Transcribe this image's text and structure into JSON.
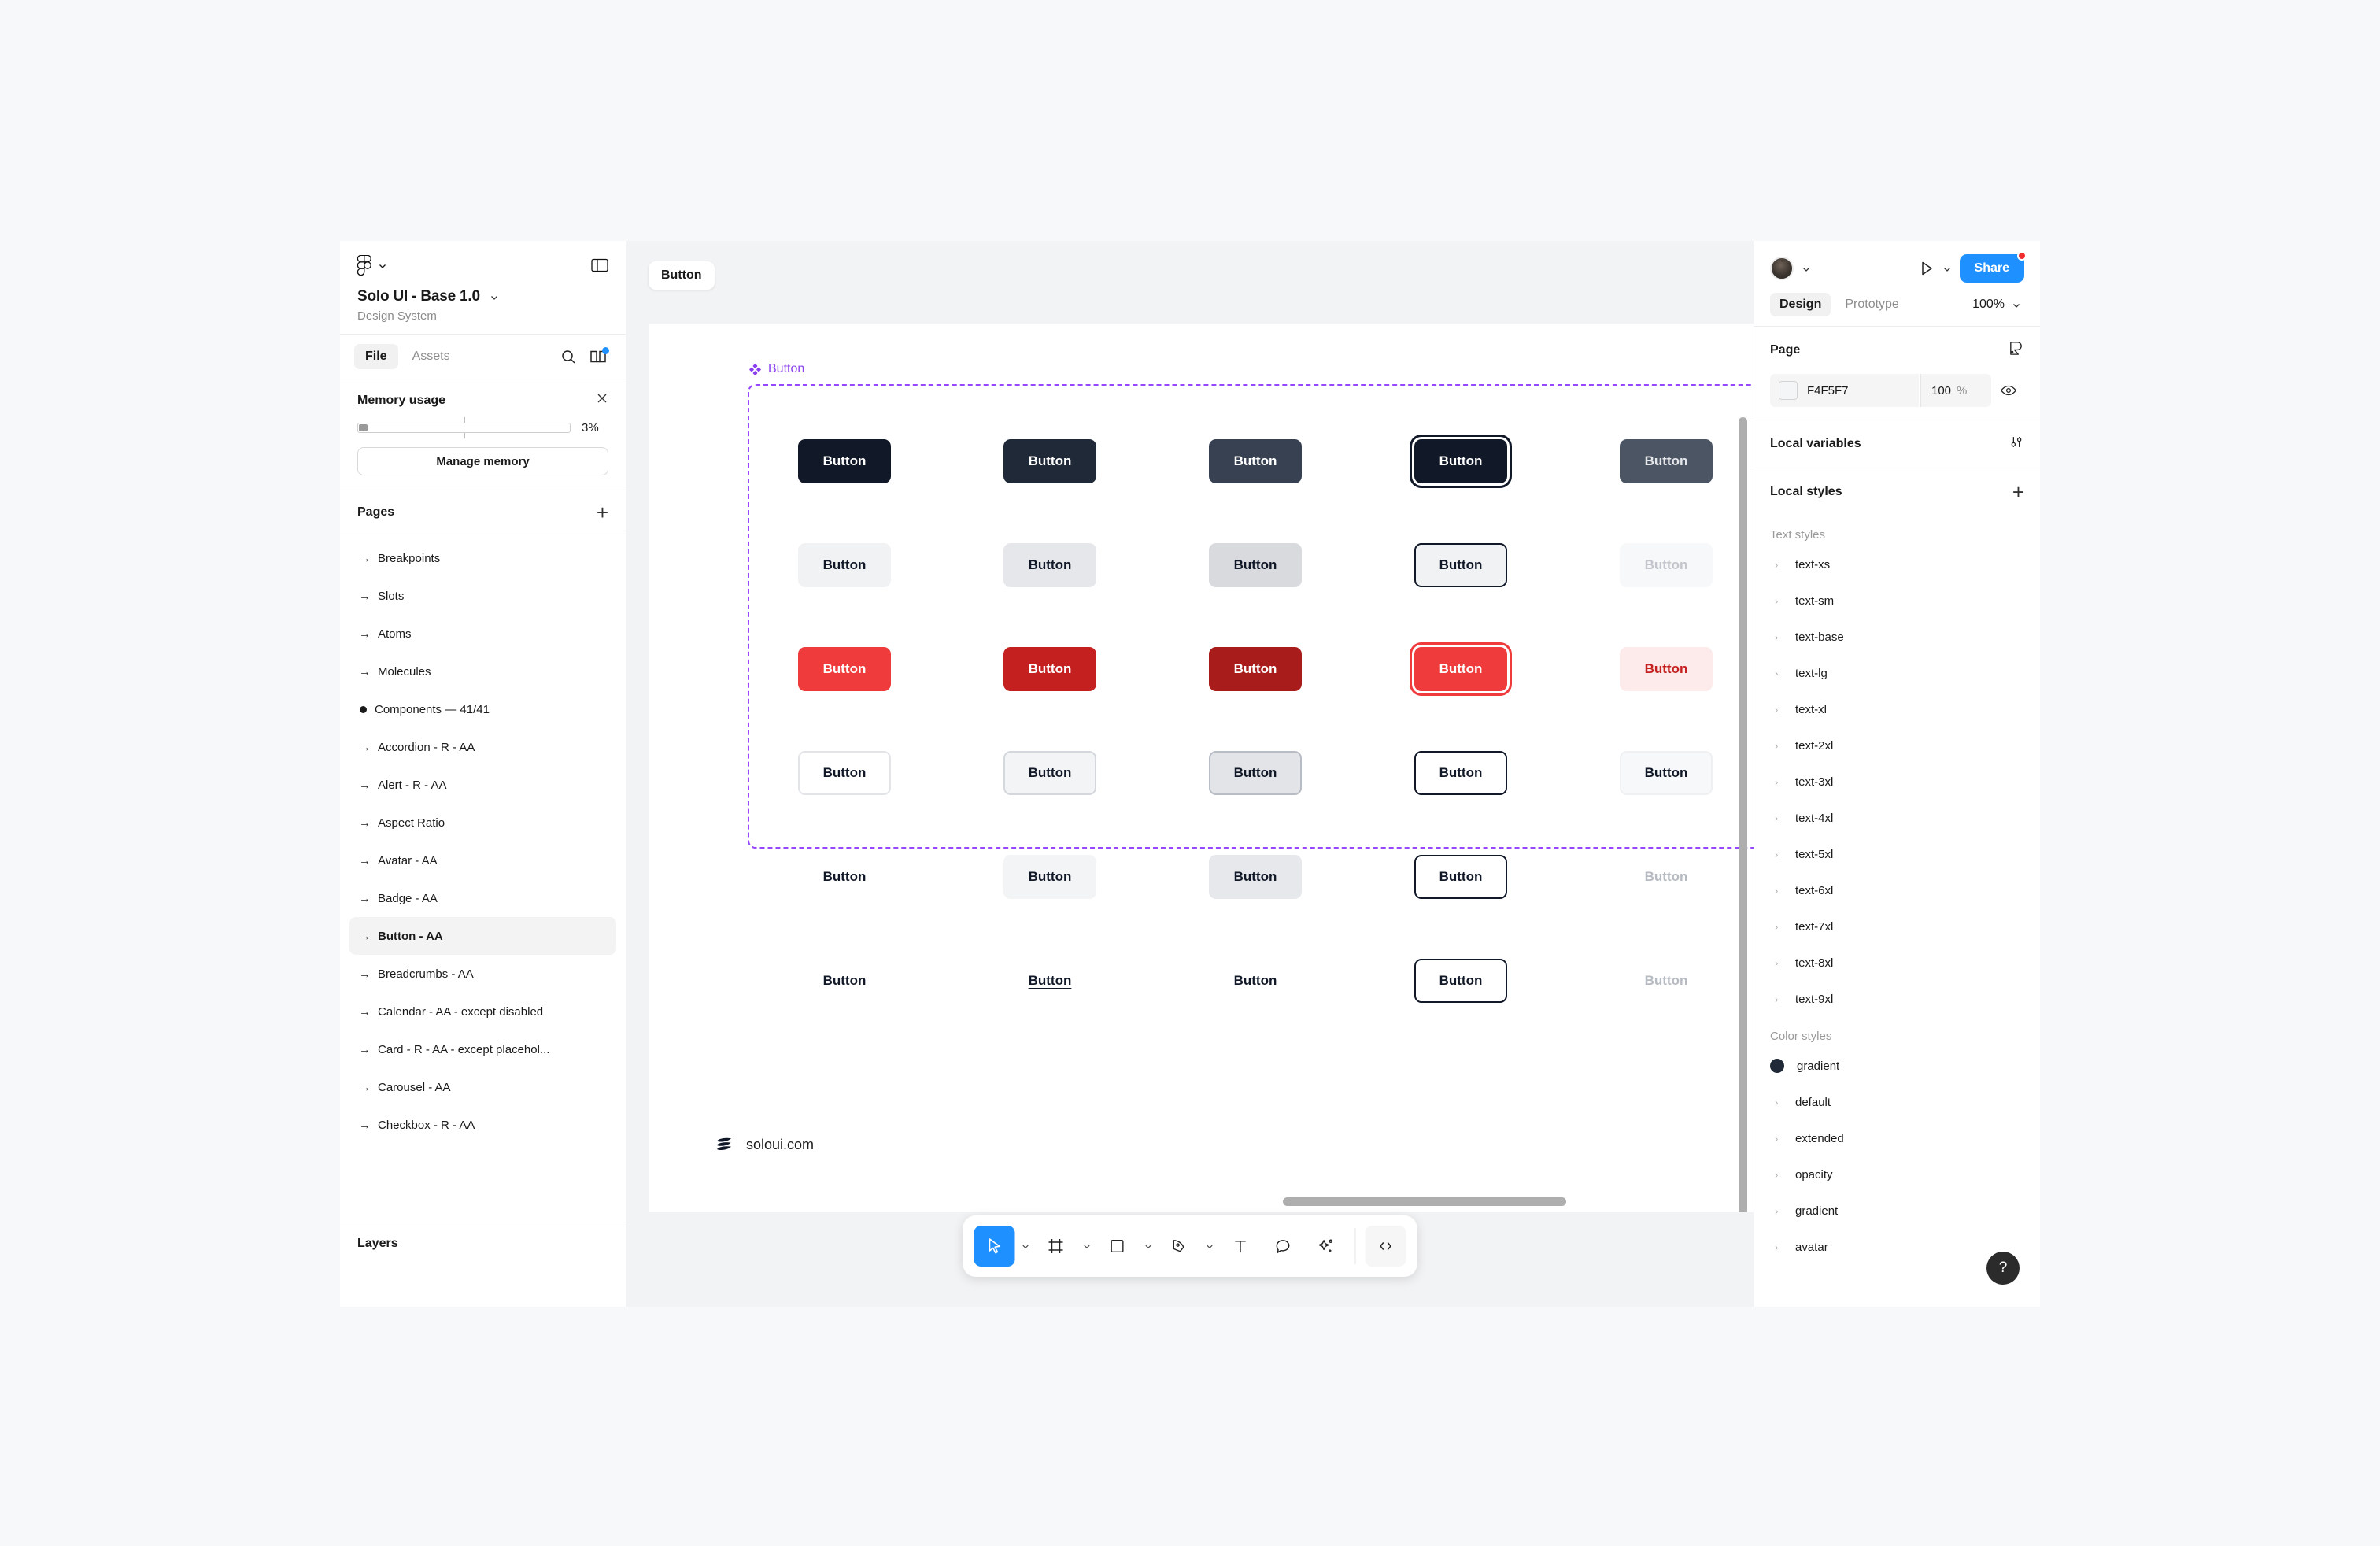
{
  "left_sidebar": {
    "logo_icon": "figma-logo-icon",
    "logo_chevron_icon": "chevron-down-icon",
    "panel_toggle_icon": "panel-toggle-icon",
    "file_title": "Solo UI - Base 1.0",
    "file_title_chevron_icon": "chevron-down-icon",
    "file_subtitle": "Design System",
    "tabs": [
      {
        "label": "File",
        "active": true
      },
      {
        "label": "Assets",
        "active": false
      }
    ],
    "search_icon": "search-icon",
    "library_icon": "book-library-icon",
    "memory": {
      "title": "Memory usage",
      "close_icon": "close-icon",
      "percent": "3%",
      "fill_percent": 3,
      "manage_label": "Manage memory"
    },
    "pages": {
      "title": "Pages",
      "add_icon": "plus-icon",
      "items": [
        {
          "label": "Breakpoints",
          "marker": "arrow",
          "selected": false
        },
        {
          "label": "Slots",
          "marker": "arrow",
          "selected": false
        },
        {
          "label": "Atoms",
          "marker": "arrow",
          "selected": false
        },
        {
          "label": "Molecules",
          "marker": "arrow",
          "selected": false
        },
        {
          "label": "Components — 41/41",
          "marker": "bullet",
          "selected": false
        },
        {
          "label": "Accordion - R - AA",
          "marker": "arrow",
          "selected": false
        },
        {
          "label": "Alert - R - AA",
          "marker": "arrow",
          "selected": false
        },
        {
          "label": "Aspect Ratio",
          "marker": "arrow",
          "selected": false
        },
        {
          "label": "Avatar - AA",
          "marker": "arrow",
          "selected": false
        },
        {
          "label": "Badge - AA",
          "marker": "arrow",
          "selected": false
        },
        {
          "label": "Button - AA",
          "marker": "arrow",
          "selected": true
        },
        {
          "label": "Breadcrumbs  - AA",
          "marker": "arrow",
          "selected": false
        },
        {
          "label": "Calendar - AA - except disabled",
          "marker": "arrow",
          "selected": false
        },
        {
          "label": "Card - R - AA - except placehol...",
          "marker": "arrow",
          "selected": false
        },
        {
          "label": "Carousel  - AA",
          "marker": "arrow",
          "selected": false
        },
        {
          "label": "Checkbox - R - AA",
          "marker": "arrow",
          "selected": false
        }
      ]
    },
    "layers_title": "Layers"
  },
  "canvas": {
    "frame_chip_label": "Button",
    "component_label": "Button",
    "component_icon": "component-diamond-icon",
    "brand_link": "soloui.com",
    "brand_logo_icon": "solo-logo-icon",
    "vertical_scrollbar": "canvas-vertical-scrollbar",
    "horizontal_scrollbar": "canvas-horizontal-scrollbar",
    "button_label": "Button",
    "grid": [
      [
        {
          "label": "Button",
          "style": "background:#111827;color:#ffffff;"
        },
        {
          "label": "Button",
          "style": "background:#1f2937;color:#ffffff;"
        },
        {
          "label": "Button",
          "style": "background:#374151;color:#ffffff;"
        },
        {
          "label": "Button",
          "style": "background:#111827;color:#ffffff;",
          "focus": "dark"
        },
        {
          "label": "Button",
          "style": "background:#4b5563;color:#e5e7eb;"
        }
      ],
      [
        {
          "label": "Button",
          "style": "background:#f1f2f4;color:#111827;"
        },
        {
          "label": "Button",
          "style": "background:#e5e7eb;color:#111827;"
        },
        {
          "label": "Button",
          "style": "background:#d8dade;color:#111827;"
        },
        {
          "label": "Button",
          "style": "background:#f1f2f4;color:#111827;border-color:#111827;"
        },
        {
          "label": "Button",
          "style": "background:#f7f8f9;color:#c2c6cc;"
        }
      ],
      [
        {
          "label": "Button",
          "style": "background:#ef3b3b;color:#ffffff;"
        },
        {
          "label": "Button",
          "style": "background:#c4201f;color:#ffffff;"
        },
        {
          "label": "Button",
          "style": "background:#a81c1b;color:#ffffff;"
        },
        {
          "label": "Button",
          "style": "background:#ef3b3b;color:#ffffff;",
          "focus": "red"
        },
        {
          "label": "Button",
          "style": "background:#fdeaea;color:#c4201f;"
        }
      ],
      [
        {
          "label": "Button",
          "style": "background:#ffffff;color:#111827;border-color:#e2e4e8;"
        },
        {
          "label": "Button",
          "style": "background:#f3f4f6;color:#111827;border-color:#d4d7dc;"
        },
        {
          "label": "Button",
          "style": "background:#e2e4e8;color:#111827;border-color:#b8bcc4;"
        },
        {
          "label": "Button",
          "style": "background:#ffffff;color:#111827;border-color:#111827;"
        },
        {
          "label": "Button",
          "style": "background:#f7f8f9;color:#111827;border-color:#eef0f2;"
        }
      ],
      [
        {
          "label": "Button",
          "style": "background:transparent;color:#111827;"
        },
        {
          "label": "Button",
          "style": "background:#f3f4f6;color:#111827;"
        },
        {
          "label": "Button",
          "style": "background:#e6e8ec;color:#111827;"
        },
        {
          "label": "Button",
          "style": "background:#ffffff;color:#111827;border-color:#111827;"
        },
        {
          "label": "Button",
          "style": "background:transparent;color:#b6bac1;"
        }
      ],
      [
        {
          "label": "Button",
          "style": "background:transparent;color:#111827;"
        },
        {
          "label": "Button",
          "style": "background:transparent;color:#111827;",
          "underline": true
        },
        {
          "label": "Button",
          "style": "background:transparent;color:#111827;"
        },
        {
          "label": "Button",
          "style": "background:#ffffff;color:#111827;border-color:#111827;"
        },
        {
          "label": "Button",
          "style": "background:transparent;color:#b6bac1;"
        }
      ]
    ]
  },
  "toolbar": {
    "tools": [
      {
        "name": "move-tool",
        "icon": "cursor-icon",
        "active": true,
        "chevron": true
      },
      {
        "name": "frame-tool",
        "icon": "frame-icon",
        "active": false,
        "chevron": true
      },
      {
        "name": "shape-tool",
        "icon": "square-icon",
        "active": false,
        "chevron": true
      },
      {
        "name": "pen-tool",
        "icon": "pen-icon",
        "active": false,
        "chevron": true
      },
      {
        "name": "text-tool",
        "icon": "text-icon",
        "active": false,
        "chevron": false
      },
      {
        "name": "comment-tool",
        "icon": "comment-icon",
        "active": false,
        "chevron": false
      },
      {
        "name": "actions-tool",
        "icon": "sparkle-icon",
        "active": false,
        "chevron": false
      }
    ],
    "dev_mode": {
      "name": "dev-mode-toggle",
      "icon": "code-icon"
    }
  },
  "right_panel": {
    "avatar_icon": "user-avatar",
    "avatar_chevron_icon": "chevron-down-icon",
    "present_icon": "play-icon",
    "present_chevron_icon": "chevron-down-icon",
    "share_label": "Share",
    "tabs": [
      {
        "label": "Design",
        "active": true
      },
      {
        "label": "Prototype",
        "active": false
      }
    ],
    "zoom_value": "100%",
    "zoom_chevron_icon": "chevron-down-icon",
    "page_section": {
      "title": "Page",
      "image_icon": "image-paint-icon",
      "color_hex": "F4F5F7",
      "opacity": "100",
      "opacity_unit": "%",
      "visibility_icon": "eye-icon"
    },
    "local_variables": {
      "title": "Local variables",
      "icon": "variables-sliders-icon"
    },
    "local_styles": {
      "title": "Local styles",
      "add_icon": "plus-icon",
      "text_styles_label": "Text styles",
      "text_styles": [
        "text-xs",
        "text-sm",
        "text-base",
        "text-lg",
        "text-xl",
        "text-2xl",
        "text-3xl",
        "text-4xl",
        "text-5xl",
        "text-6xl",
        "text-7xl",
        "text-8xl",
        "text-9xl"
      ],
      "color_styles_label": "Color styles",
      "color_styles": [
        {
          "label": "gradient",
          "type": "swatch",
          "color": "#1f2937"
        },
        {
          "label": "default",
          "type": "folder"
        },
        {
          "label": "extended",
          "type": "folder"
        },
        {
          "label": "opacity",
          "type": "folder"
        },
        {
          "label": "gradient",
          "type": "folder"
        },
        {
          "label": "avatar",
          "type": "folder"
        }
      ]
    },
    "help_label": "?"
  }
}
